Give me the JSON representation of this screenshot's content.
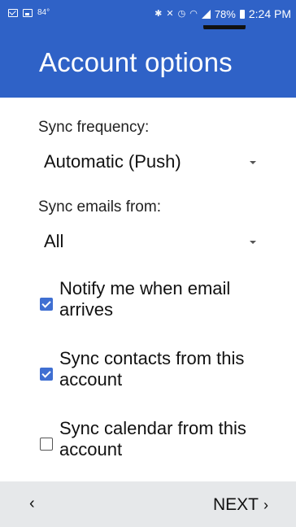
{
  "status_bar": {
    "temperature": "84°",
    "battery_percent": "78%",
    "time": "2:24 PM"
  },
  "header": {
    "title": "Account options"
  },
  "sync_frequency": {
    "label": "Sync frequency:",
    "value": "Automatic (Push)"
  },
  "sync_emails_from": {
    "label": "Sync emails from:",
    "value": "All"
  },
  "options": [
    {
      "label": "Notify me when email arrives",
      "checked": true
    },
    {
      "label": "Sync contacts from this account",
      "checked": true
    },
    {
      "label": "Sync calendar from this account",
      "checked": false
    }
  ],
  "footer": {
    "back_label": "‹",
    "next_label": "NEXT",
    "next_chevron": "›"
  },
  "colors": {
    "primary": "#2f62c7",
    "checkbox": "#3f6fd2",
    "footer_bg": "#e6e8ea"
  }
}
